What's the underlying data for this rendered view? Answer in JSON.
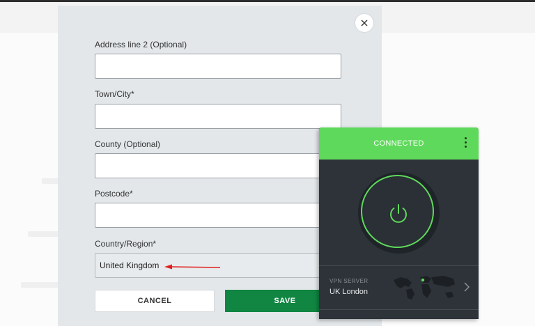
{
  "form": {
    "fields": [
      {
        "label": "Address line 2 (Optional)",
        "value": ""
      },
      {
        "label": "Town/City*",
        "value": ""
      },
      {
        "label": "County (Optional)",
        "value": ""
      },
      {
        "label": "Postcode*",
        "value": ""
      },
      {
        "label": "Country/Region*",
        "value": "United Kingdom"
      }
    ],
    "cancel_label": "CANCEL",
    "save_label": "SAVE"
  },
  "vpn": {
    "status": "CONNECTED",
    "server_label": "VPN SERVER",
    "server_name": "UK London"
  },
  "colors": {
    "save_green": "#108642",
    "vpn_green": "#5fd95c",
    "vpn_body": "#2d3339",
    "annotation_arrow": "#e0201d"
  },
  "icons": [
    "close-icon",
    "more-vertical-icon",
    "power-icon",
    "world-map-icon",
    "chevron-right-icon",
    "red-arrow-annotation"
  ]
}
